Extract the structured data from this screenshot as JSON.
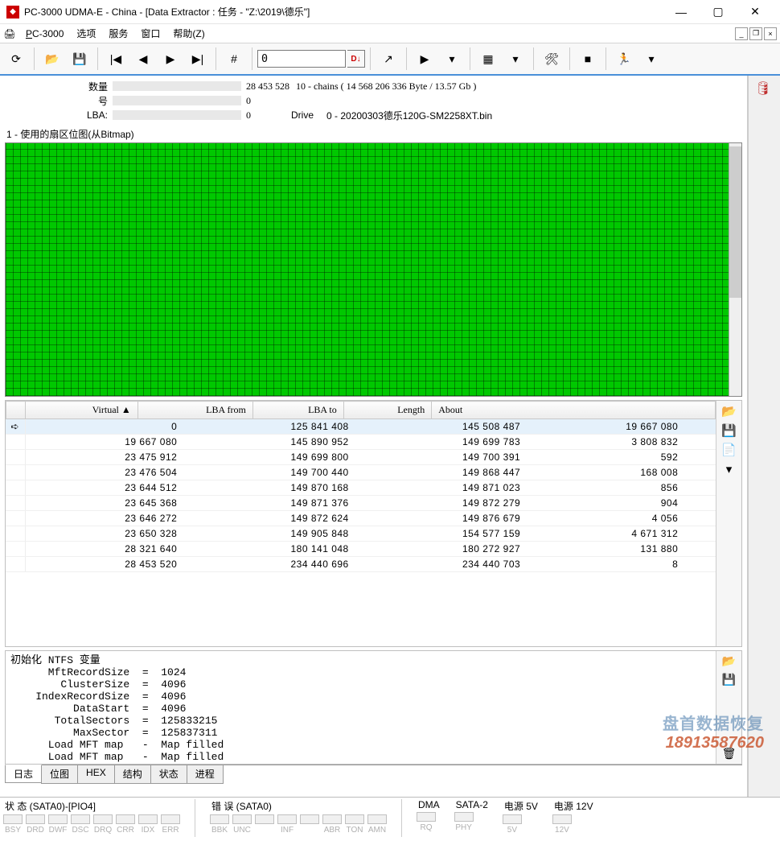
{
  "window": {
    "title": "PC-3000 UDMA-E - China - [Data Extractor : 任务 - \"Z:\\2019\\德乐\"]"
  },
  "menu": {
    "app": "PC-3000",
    "items": [
      "选项",
      "服务",
      "窗口",
      "帮助(Z)"
    ]
  },
  "toolbar": {
    "input_value": "0",
    "input_label": "D↓"
  },
  "info": {
    "count_label": "数量",
    "count_value": "28 453 528",
    "count_extra": "10 - chains  ( 14 568 206 336 Byte /  13.57 Gb )",
    "num_label": "号",
    "num_value": "0",
    "lba_label": "LBA:",
    "lba_value": "0",
    "drive_label": "Drive",
    "drive_value": "0 - 20200303德乐120G-SM2258XT.bin"
  },
  "bitmap": {
    "title": "1 - 使用的扇区位图(从Bitmap)"
  },
  "table": {
    "headers": [
      "Virtual ▲",
      "LBA from",
      "LBA to",
      "Length",
      "About"
    ],
    "rows": [
      {
        "sel": true,
        "virtual": "0",
        "from": "125 841 408",
        "to": "145 508 487",
        "len": "19 667 080",
        "about": ""
      },
      {
        "virtual": "19 667 080",
        "from": "145 890 952",
        "to": "149 699 783",
        "len": "3 808 832",
        "about": ""
      },
      {
        "virtual": "23 475 912",
        "from": "149 699 800",
        "to": "149 700 391",
        "len": "592",
        "about": ""
      },
      {
        "virtual": "23 476 504",
        "from": "149 700 440",
        "to": "149 868 447",
        "len": "168 008",
        "about": ""
      },
      {
        "virtual": "23 644 512",
        "from": "149 870 168",
        "to": "149 871 023",
        "len": "856",
        "about": ""
      },
      {
        "virtual": "23 645 368",
        "from": "149 871 376",
        "to": "149 872 279",
        "len": "904",
        "about": ""
      },
      {
        "virtual": "23 646 272",
        "from": "149 872 624",
        "to": "149 876 679",
        "len": "4 056",
        "about": ""
      },
      {
        "virtual": "23 650 328",
        "from": "149 905 848",
        "to": "154 577 159",
        "len": "4 671 312",
        "about": ""
      },
      {
        "virtual": "28 321 640",
        "from": "180 141 048",
        "to": "180 272 927",
        "len": "131 880",
        "about": ""
      },
      {
        "virtual": "28 453 520",
        "from": "234 440 696",
        "to": "234 440 703",
        "len": "8",
        "about": ""
      }
    ]
  },
  "log": {
    "text": "初始化 NTFS 变量\n      MftRecordSize  =  1024\n        ClusterSize  =  4096\n    IndexRecordSize  =  4096\n          DataStart  =  4096\n       TotalSectors  =  125833215\n          MaxSector  =  125837311\n      Load MFT map   -  Map filled\n      Load MFT map   -  Map filled"
  },
  "tabs": {
    "items": [
      "日志",
      "位图",
      "HEX",
      "结构",
      "状态",
      "进程"
    ],
    "active": 0
  },
  "status": {
    "group1_title": "状 态 (SATA0)-[PIO4]",
    "group1": [
      "BSY",
      "DRD",
      "DWF",
      "DSC",
      "DRQ",
      "CRR",
      "IDX",
      "ERR"
    ],
    "group2_title": "错 误 (SATA0)",
    "group2": [
      "BBK",
      "UNC",
      "",
      "INF",
      "",
      "ABR",
      "TON",
      "AMN"
    ],
    "dma_title": "DMA",
    "dma": [
      "RQ"
    ],
    "sata_title": "SATA-2",
    "sata": [
      "PHY"
    ],
    "p5_title": "电源 5V",
    "p5": [
      "5V"
    ],
    "p12_title": "电源 12V",
    "p12": [
      "12V"
    ]
  },
  "watermark": {
    "line1": "盘首数据恢复",
    "line2": "18913587620"
  }
}
